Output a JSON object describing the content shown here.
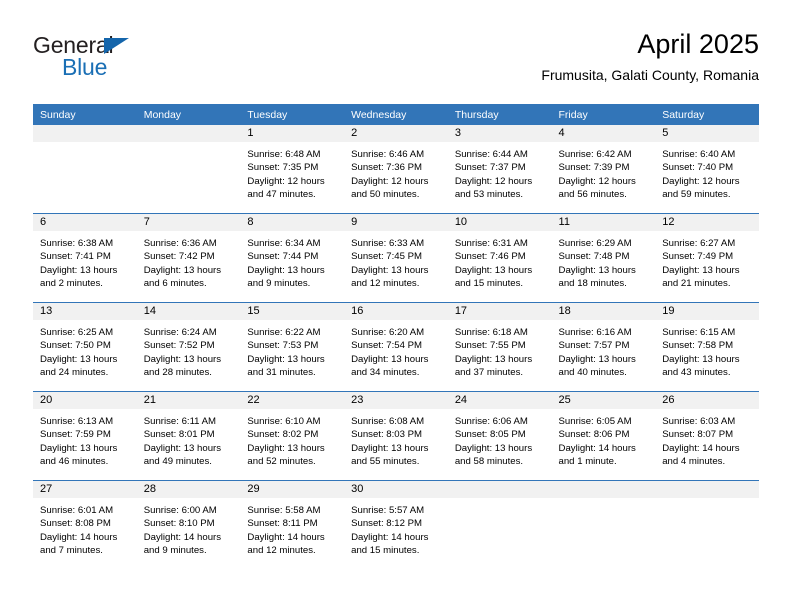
{
  "logo": {
    "word1": "General",
    "word2": "Blue",
    "triangle_color": "#1465ab",
    "word2_color": "#1a6fb5"
  },
  "header": {
    "title": "April 2025",
    "subtitle": "Frumusita, Galati County, Romania"
  },
  "theme": {
    "header_blue": "#3275b8",
    "daynum_band": "#f1f1f1",
    "cell_background": "#ffffff"
  },
  "weekday_headers": [
    "Sunday",
    "Monday",
    "Tuesday",
    "Wednesday",
    "Thursday",
    "Friday",
    "Saturday"
  ],
  "weeks": [
    [
      {
        "day": "",
        "sunrise": "",
        "sunset": "",
        "daylight1": "",
        "daylight2": ""
      },
      {
        "day": "",
        "sunrise": "",
        "sunset": "",
        "daylight1": "",
        "daylight2": ""
      },
      {
        "day": "1",
        "sunrise": "Sunrise: 6:48 AM",
        "sunset": "Sunset: 7:35 PM",
        "daylight1": "Daylight: 12 hours",
        "daylight2": "and 47 minutes."
      },
      {
        "day": "2",
        "sunrise": "Sunrise: 6:46 AM",
        "sunset": "Sunset: 7:36 PM",
        "daylight1": "Daylight: 12 hours",
        "daylight2": "and 50 minutes."
      },
      {
        "day": "3",
        "sunrise": "Sunrise: 6:44 AM",
        "sunset": "Sunset: 7:37 PM",
        "daylight1": "Daylight: 12 hours",
        "daylight2": "and 53 minutes."
      },
      {
        "day": "4",
        "sunrise": "Sunrise: 6:42 AM",
        "sunset": "Sunset: 7:39 PM",
        "daylight1": "Daylight: 12 hours",
        "daylight2": "and 56 minutes."
      },
      {
        "day": "5",
        "sunrise": "Sunrise: 6:40 AM",
        "sunset": "Sunset: 7:40 PM",
        "daylight1": "Daylight: 12 hours",
        "daylight2": "and 59 minutes."
      }
    ],
    [
      {
        "day": "6",
        "sunrise": "Sunrise: 6:38 AM",
        "sunset": "Sunset: 7:41 PM",
        "daylight1": "Daylight: 13 hours",
        "daylight2": "and 2 minutes."
      },
      {
        "day": "7",
        "sunrise": "Sunrise: 6:36 AM",
        "sunset": "Sunset: 7:42 PM",
        "daylight1": "Daylight: 13 hours",
        "daylight2": "and 6 minutes."
      },
      {
        "day": "8",
        "sunrise": "Sunrise: 6:34 AM",
        "sunset": "Sunset: 7:44 PM",
        "daylight1": "Daylight: 13 hours",
        "daylight2": "and 9 minutes."
      },
      {
        "day": "9",
        "sunrise": "Sunrise: 6:33 AM",
        "sunset": "Sunset: 7:45 PM",
        "daylight1": "Daylight: 13 hours",
        "daylight2": "and 12 minutes."
      },
      {
        "day": "10",
        "sunrise": "Sunrise: 6:31 AM",
        "sunset": "Sunset: 7:46 PM",
        "daylight1": "Daylight: 13 hours",
        "daylight2": "and 15 minutes."
      },
      {
        "day": "11",
        "sunrise": "Sunrise: 6:29 AM",
        "sunset": "Sunset: 7:48 PM",
        "daylight1": "Daylight: 13 hours",
        "daylight2": "and 18 minutes."
      },
      {
        "day": "12",
        "sunrise": "Sunrise: 6:27 AM",
        "sunset": "Sunset: 7:49 PM",
        "daylight1": "Daylight: 13 hours",
        "daylight2": "and 21 minutes."
      }
    ],
    [
      {
        "day": "13",
        "sunrise": "Sunrise: 6:25 AM",
        "sunset": "Sunset: 7:50 PM",
        "daylight1": "Daylight: 13 hours",
        "daylight2": "and 24 minutes."
      },
      {
        "day": "14",
        "sunrise": "Sunrise: 6:24 AM",
        "sunset": "Sunset: 7:52 PM",
        "daylight1": "Daylight: 13 hours",
        "daylight2": "and 28 minutes."
      },
      {
        "day": "15",
        "sunrise": "Sunrise: 6:22 AM",
        "sunset": "Sunset: 7:53 PM",
        "daylight1": "Daylight: 13 hours",
        "daylight2": "and 31 minutes."
      },
      {
        "day": "16",
        "sunrise": "Sunrise: 6:20 AM",
        "sunset": "Sunset: 7:54 PM",
        "daylight1": "Daylight: 13 hours",
        "daylight2": "and 34 minutes."
      },
      {
        "day": "17",
        "sunrise": "Sunrise: 6:18 AM",
        "sunset": "Sunset: 7:55 PM",
        "daylight1": "Daylight: 13 hours",
        "daylight2": "and 37 minutes."
      },
      {
        "day": "18",
        "sunrise": "Sunrise: 6:16 AM",
        "sunset": "Sunset: 7:57 PM",
        "daylight1": "Daylight: 13 hours",
        "daylight2": "and 40 minutes."
      },
      {
        "day": "19",
        "sunrise": "Sunrise: 6:15 AM",
        "sunset": "Sunset: 7:58 PM",
        "daylight1": "Daylight: 13 hours",
        "daylight2": "and 43 minutes."
      }
    ],
    [
      {
        "day": "20",
        "sunrise": "Sunrise: 6:13 AM",
        "sunset": "Sunset: 7:59 PM",
        "daylight1": "Daylight: 13 hours",
        "daylight2": "and 46 minutes."
      },
      {
        "day": "21",
        "sunrise": "Sunrise: 6:11 AM",
        "sunset": "Sunset: 8:01 PM",
        "daylight1": "Daylight: 13 hours",
        "daylight2": "and 49 minutes."
      },
      {
        "day": "22",
        "sunrise": "Sunrise: 6:10 AM",
        "sunset": "Sunset: 8:02 PM",
        "daylight1": "Daylight: 13 hours",
        "daylight2": "and 52 minutes."
      },
      {
        "day": "23",
        "sunrise": "Sunrise: 6:08 AM",
        "sunset": "Sunset: 8:03 PM",
        "daylight1": "Daylight: 13 hours",
        "daylight2": "and 55 minutes."
      },
      {
        "day": "24",
        "sunrise": "Sunrise: 6:06 AM",
        "sunset": "Sunset: 8:05 PM",
        "daylight1": "Daylight: 13 hours",
        "daylight2": "and 58 minutes."
      },
      {
        "day": "25",
        "sunrise": "Sunrise: 6:05 AM",
        "sunset": "Sunset: 8:06 PM",
        "daylight1": "Daylight: 14 hours",
        "daylight2": "and 1 minute."
      },
      {
        "day": "26",
        "sunrise": "Sunrise: 6:03 AM",
        "sunset": "Sunset: 8:07 PM",
        "daylight1": "Daylight: 14 hours",
        "daylight2": "and 4 minutes."
      }
    ],
    [
      {
        "day": "27",
        "sunrise": "Sunrise: 6:01 AM",
        "sunset": "Sunset: 8:08 PM",
        "daylight1": "Daylight: 14 hours",
        "daylight2": "and 7 minutes."
      },
      {
        "day": "28",
        "sunrise": "Sunrise: 6:00 AM",
        "sunset": "Sunset: 8:10 PM",
        "daylight1": "Daylight: 14 hours",
        "daylight2": "and 9 minutes."
      },
      {
        "day": "29",
        "sunrise": "Sunrise: 5:58 AM",
        "sunset": "Sunset: 8:11 PM",
        "daylight1": "Daylight: 14 hours",
        "daylight2": "and 12 minutes."
      },
      {
        "day": "30",
        "sunrise": "Sunrise: 5:57 AM",
        "sunset": "Sunset: 8:12 PM",
        "daylight1": "Daylight: 14 hours",
        "daylight2": "and 15 minutes."
      },
      {
        "day": "",
        "sunrise": "",
        "sunset": "",
        "daylight1": "",
        "daylight2": ""
      },
      {
        "day": "",
        "sunrise": "",
        "sunset": "",
        "daylight1": "",
        "daylight2": ""
      },
      {
        "day": "",
        "sunrise": "",
        "sunset": "",
        "daylight1": "",
        "daylight2": ""
      }
    ]
  ]
}
